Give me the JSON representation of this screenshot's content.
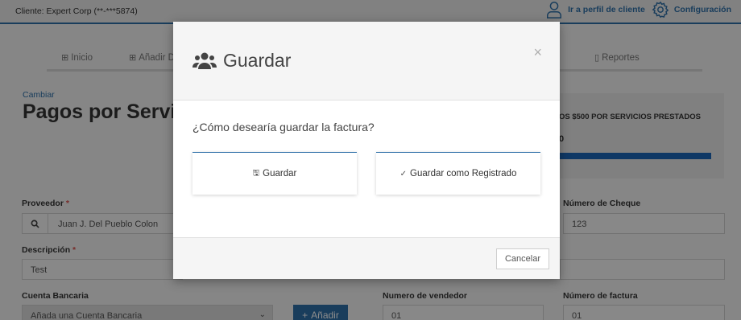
{
  "topbar": {
    "client_label": "Cliente: Expert Corp (**-***5874)",
    "profile_link": "Ir a perfil de cliente",
    "config_link": "Configuración"
  },
  "nav": {
    "items": [
      {
        "label": "Inicio",
        "icon": "table-icon"
      },
      {
        "label": "Añadir D",
        "icon": "plus-square-icon"
      },
      {
        "label": "Reportes",
        "icon": "clipboard-icon"
      }
    ]
  },
  "page": {
    "change_link": "Cambiar",
    "title": "Pagos por Servicios"
  },
  "promo": {
    "text": "OS $500 POR SERVICIOS PRESTADOS",
    "number": "0",
    "bar_color": "#1d66b8"
  },
  "form": {
    "proveedor": {
      "label": "Proveedor",
      "required": "*",
      "value": "Juan J. Del Pueblo Colon"
    },
    "descripcion": {
      "label": "Descripción",
      "required": "*",
      "value": "Test"
    },
    "cuenta": {
      "label": "Cuenta Bancaria",
      "value": "Añada una Cuenta Bancaria"
    },
    "add_button": "Añadir",
    "num_vendedor": {
      "label": "Numero de vendedor",
      "value": "01"
    },
    "num_cheque": {
      "label": "Número de Cheque",
      "value": "123"
    },
    "num_factura": {
      "label": "Número de factura",
      "value": "01"
    }
  },
  "modal": {
    "title": "Guardar",
    "close": "×",
    "question": "¿Cómo desearía guardar la factura?",
    "options": [
      {
        "label": "Guardar",
        "icon": "save-icon"
      },
      {
        "label": "Guardar como Registrado",
        "icon": "check-icon"
      }
    ],
    "cancel": "Cancelar"
  },
  "colors": {
    "accent": "#2e6fa8",
    "required": "#d9534f"
  }
}
